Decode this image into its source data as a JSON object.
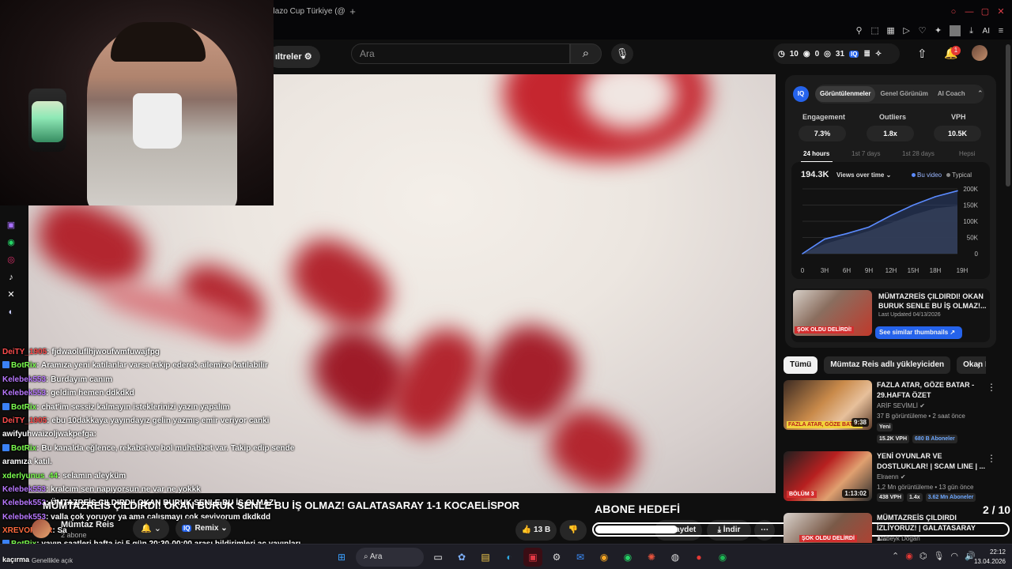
{
  "browser": {
    "tab_title": "olazo Cup Türkiye (@",
    "ai_label": "AI"
  },
  "header": {
    "filters_label": "ıltreler",
    "search_placeholder": "Ara",
    "stats": {
      "a": "10",
      "b": "0",
      "c": "31"
    },
    "iq_label": "IQ",
    "notification_count": "1"
  },
  "chat": [
    {
      "user": "DeiTY_1905",
      "color": "red",
      "badge": false,
      "msg": ": fjdwaoluflhjwoufwmfuwajfpg"
    },
    {
      "user": "BotRix",
      "color": "green",
      "badge": true,
      "msg": ": Aramıza yeni katılanlar varsa takip ederek ailemize katılabilir"
    },
    {
      "user": "Kelebek553",
      "color": "purple",
      "badge": false,
      "msg": ": Burdayım canım"
    },
    {
      "user": "Kelebek553",
      "color": "purple",
      "badge": false,
      "msg": ": geldim hemen ddkdkd"
    },
    {
      "user": "BotRix",
      "color": "green",
      "badge": true,
      "msg": ": chat'im sessiz kalmayın isteklerinizi yazın yapalım"
    },
    {
      "user": "DeiTY_1905",
      "color": "red",
      "badge": false,
      "msg": ": ebu 10dakkaya yayındayız gelin yazmış emir veriyor canki"
    },
    {
      "user": "",
      "color": "white",
      "badge": false,
      "msg": "awifyuhwaizoljwakpefga:"
    },
    {
      "user": "BotRix",
      "color": "green",
      "badge": true,
      "msg": ": Bu kanalda eğlence, rekabet ve bol muhabbet var. Takip edip sende"
    },
    {
      "user": "",
      "color": "white",
      "badge": false,
      "msg": "aramıza katıl."
    },
    {
      "user": "xderlyunus_44",
      "color": "green",
      "badge": false,
      "msg": ": selamın aleyküm"
    },
    {
      "user": "Kelebek553",
      "color": "purple",
      "badge": false,
      "msg": ": kralcım sen napıyorsun ne var ne yokkk"
    },
    {
      "user": "Kelebek553",
      "color": "purple",
      "badge": false,
      "msg": ": ÜMTAZREİS ÇILDIRDI! OKAN BURUK SENLE BU İŞ OLMAZ!"
    },
    {
      "user": "Kelebek553",
      "color": "purple",
      "badge": false,
      "msg": ": valla çok yoruyor ya ama çalışmayı çok seviyorum dkdkdd"
    },
    {
      "user": "XREVORDER",
      "color": "orange",
      "badge": false,
      "msg": ": Sa"
    },
    {
      "user": "BotRix",
      "color": "green",
      "badge": true,
      "msg": ": yayın saatleri hafta içi 5 gün 20:30-00:00 arası bildirimleri aç yayınları"
    }
  ],
  "chat_tail": "kaçırma",
  "video": {
    "title": "MÜMTAZREİS ÇILDIRDI! OKAN BURUK SENLE BU İŞ OLMAZ! GALATASARAY 1-1 KOCAELİSPOR",
    "channel": "Mümtaz Reis",
    "subscribers": "2 abone",
    "remix_label": "Remix",
    "likes": "13 B",
    "save_label": "Kaydet",
    "download_label": "İndir"
  },
  "goal": {
    "title": "ABONE HEDEFİ",
    "count": "2 / 10",
    "progress": 0.2
  },
  "iq_panel": {
    "logo": "IQ",
    "tabs": [
      "Görüntülenmeler",
      "Genel Görünüm",
      "AI Coach"
    ],
    "metrics": [
      {
        "label": "Engagement",
        "value": "7.3%"
      },
      {
        "label": "Outliers",
        "value": "1.8x"
      },
      {
        "label": "VPH",
        "value": "10.5K"
      }
    ],
    "time_tabs": [
      "24 hours",
      "1st 7 days",
      "1st 28 days",
      "Hepsi"
    ],
    "total": "194.3K",
    "metric_select": "Views over time",
    "legend": [
      "Bu video",
      "Typical"
    ],
    "thumb_title": "MÜMTAZREİS ÇILDIRDI! OKAN BURUK SENLE BU İŞ OLMAZ!...",
    "thumb_updated": "Last Updated 04/13/2026",
    "thumb_btn": "See similar thumbnails",
    "thumb_overlay": "ŞOK OLDU DELİRDİ!"
  },
  "chart_data": {
    "type": "area",
    "x": [
      "0",
      "3H",
      "6H",
      "9H",
      "12H",
      "15H",
      "18H",
      "19H"
    ],
    "series": [
      {
        "name": "Bu video",
        "values": [
          0,
          45,
          62,
          82,
          118,
          150,
          176,
          194
        ]
      },
      {
        "name": "Typical",
        "values": [
          0,
          30,
          50,
          70,
          95,
          120,
          140,
          148
        ]
      }
    ],
    "yticks": [
      "200K",
      "150K",
      "100K",
      "50K",
      "0"
    ],
    "ylim": [
      0,
      200
    ],
    "title": "",
    "xlabel": "",
    "ylabel": ""
  },
  "chips": [
    "Tümü",
    "Mümtaz Reis adlı yükleyiciden",
    "Okan B"
  ],
  "recs": [
    {
      "title": "FAZLA ATAR, GÖZE BATAR - 29.HAFTA ÖZET",
      "channel": "ARİF SEVİMLİ",
      "meta": "37 B görüntüleme • 2 saat önce",
      "badges": [
        "Yeni",
        "15.2K VPH",
        "680 B Aboneler"
      ],
      "duration": "9:38",
      "overlay": "FAZLA ATAR, GÖZE BATAR"
    },
    {
      "title": "YENİ OYUNLAR VE DOSTLUKLAR! | SCAM LINE | ...",
      "channel": "Elraenn",
      "meta": "1,2 Mn görüntüleme • 13 gün önce",
      "badges": [
        "438 VPH",
        "1.4x",
        "3.62 Mn Aboneler"
      ],
      "duration": "1:13:02",
      "overlay": "BÖLÜM 3"
    },
    {
      "title": "MÜMTAZREİS ÇILDIRDI İZLİYORUZ! | GALATASARAY 1...",
      "channel": "Atabeyk Doğan",
      "meta": "",
      "badges": [],
      "duration": "",
      "overlay": "ŞOK OLDU DELİRDİ"
    }
  ],
  "taskbar": {
    "weather": "Genellikle açık",
    "search_label": "Ara",
    "time": "22:12",
    "date": "13.04.2026"
  },
  "colors": {
    "accent": "#2563eb",
    "yt_red": "#e53935",
    "chart_line": "#5b8bff",
    "chart_typical": "#8a8a8a"
  }
}
